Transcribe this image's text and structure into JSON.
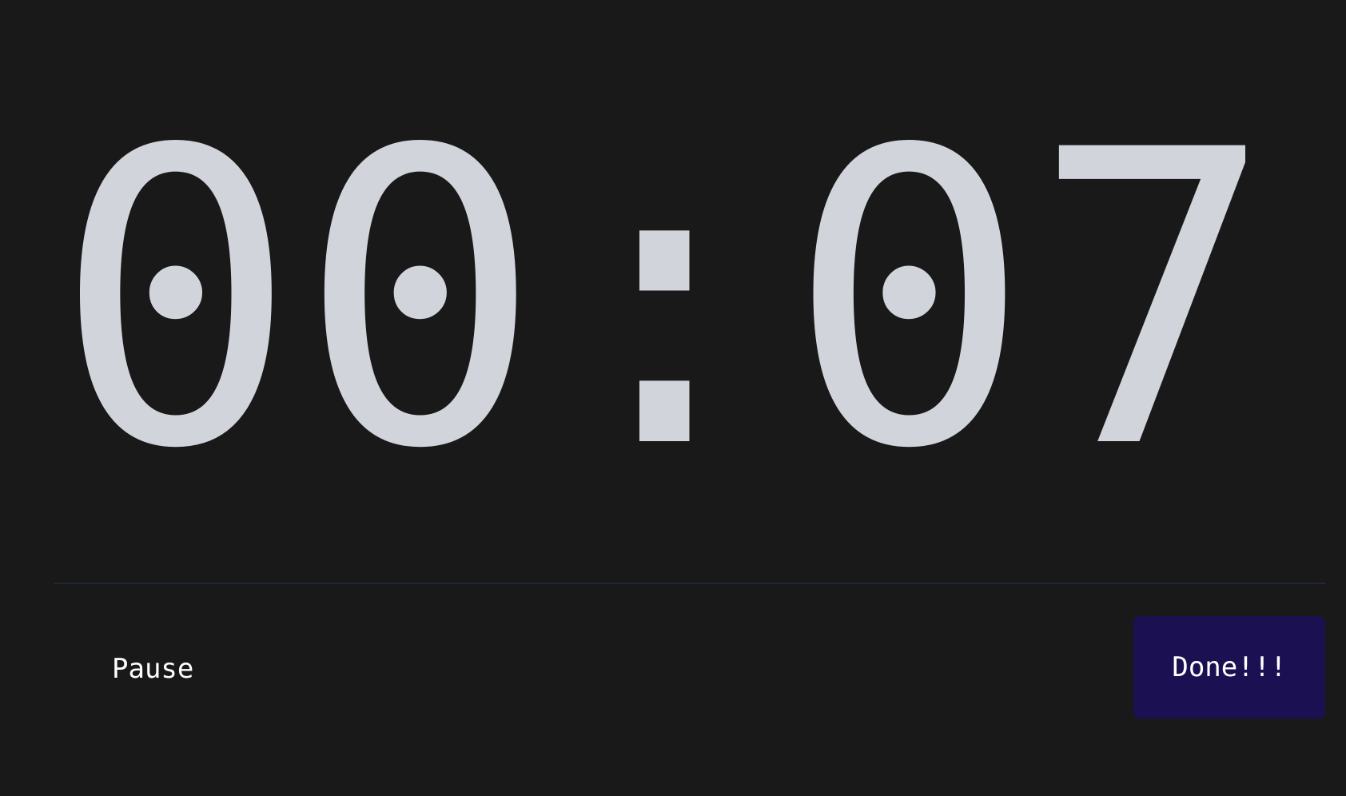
{
  "timer": {
    "display": "00:07"
  },
  "controls": {
    "pause_label": "Pause",
    "done_label": "Done!!!"
  },
  "colors": {
    "background": "#191919",
    "digits": "#d1d5db",
    "done_button": "#1b1052",
    "separator": "#1f2a36"
  }
}
